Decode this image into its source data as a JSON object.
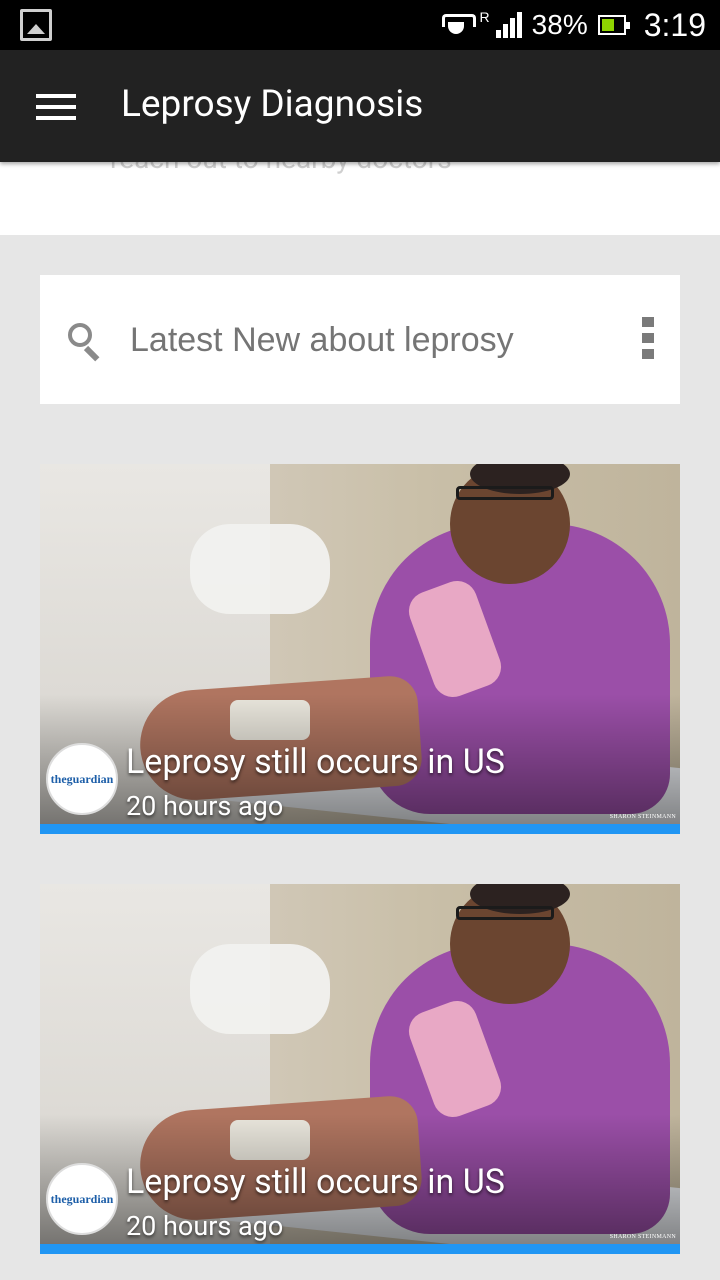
{
  "status_bar": {
    "roaming": "R",
    "battery": "38%",
    "time": "3:19"
  },
  "app_bar": {
    "title": "Leprosy Diagnosis"
  },
  "top_card": {
    "text": "reach out to nearby doctors"
  },
  "search": {
    "placeholder": "Latest New about leprosy"
  },
  "news": [
    {
      "source": "theguardian",
      "title": "Leprosy still occurs in US",
      "time": "20 hours ago",
      "credit": "SHARON STEINMANN"
    },
    {
      "source": "theguardian",
      "title": "Leprosy still occurs in US",
      "time": "20 hours ago",
      "credit": "SHARON STEINMANN"
    }
  ],
  "colors": {
    "app_bar": "#222222",
    "accent": "#2196f3",
    "background": "#e6e6e6"
  }
}
